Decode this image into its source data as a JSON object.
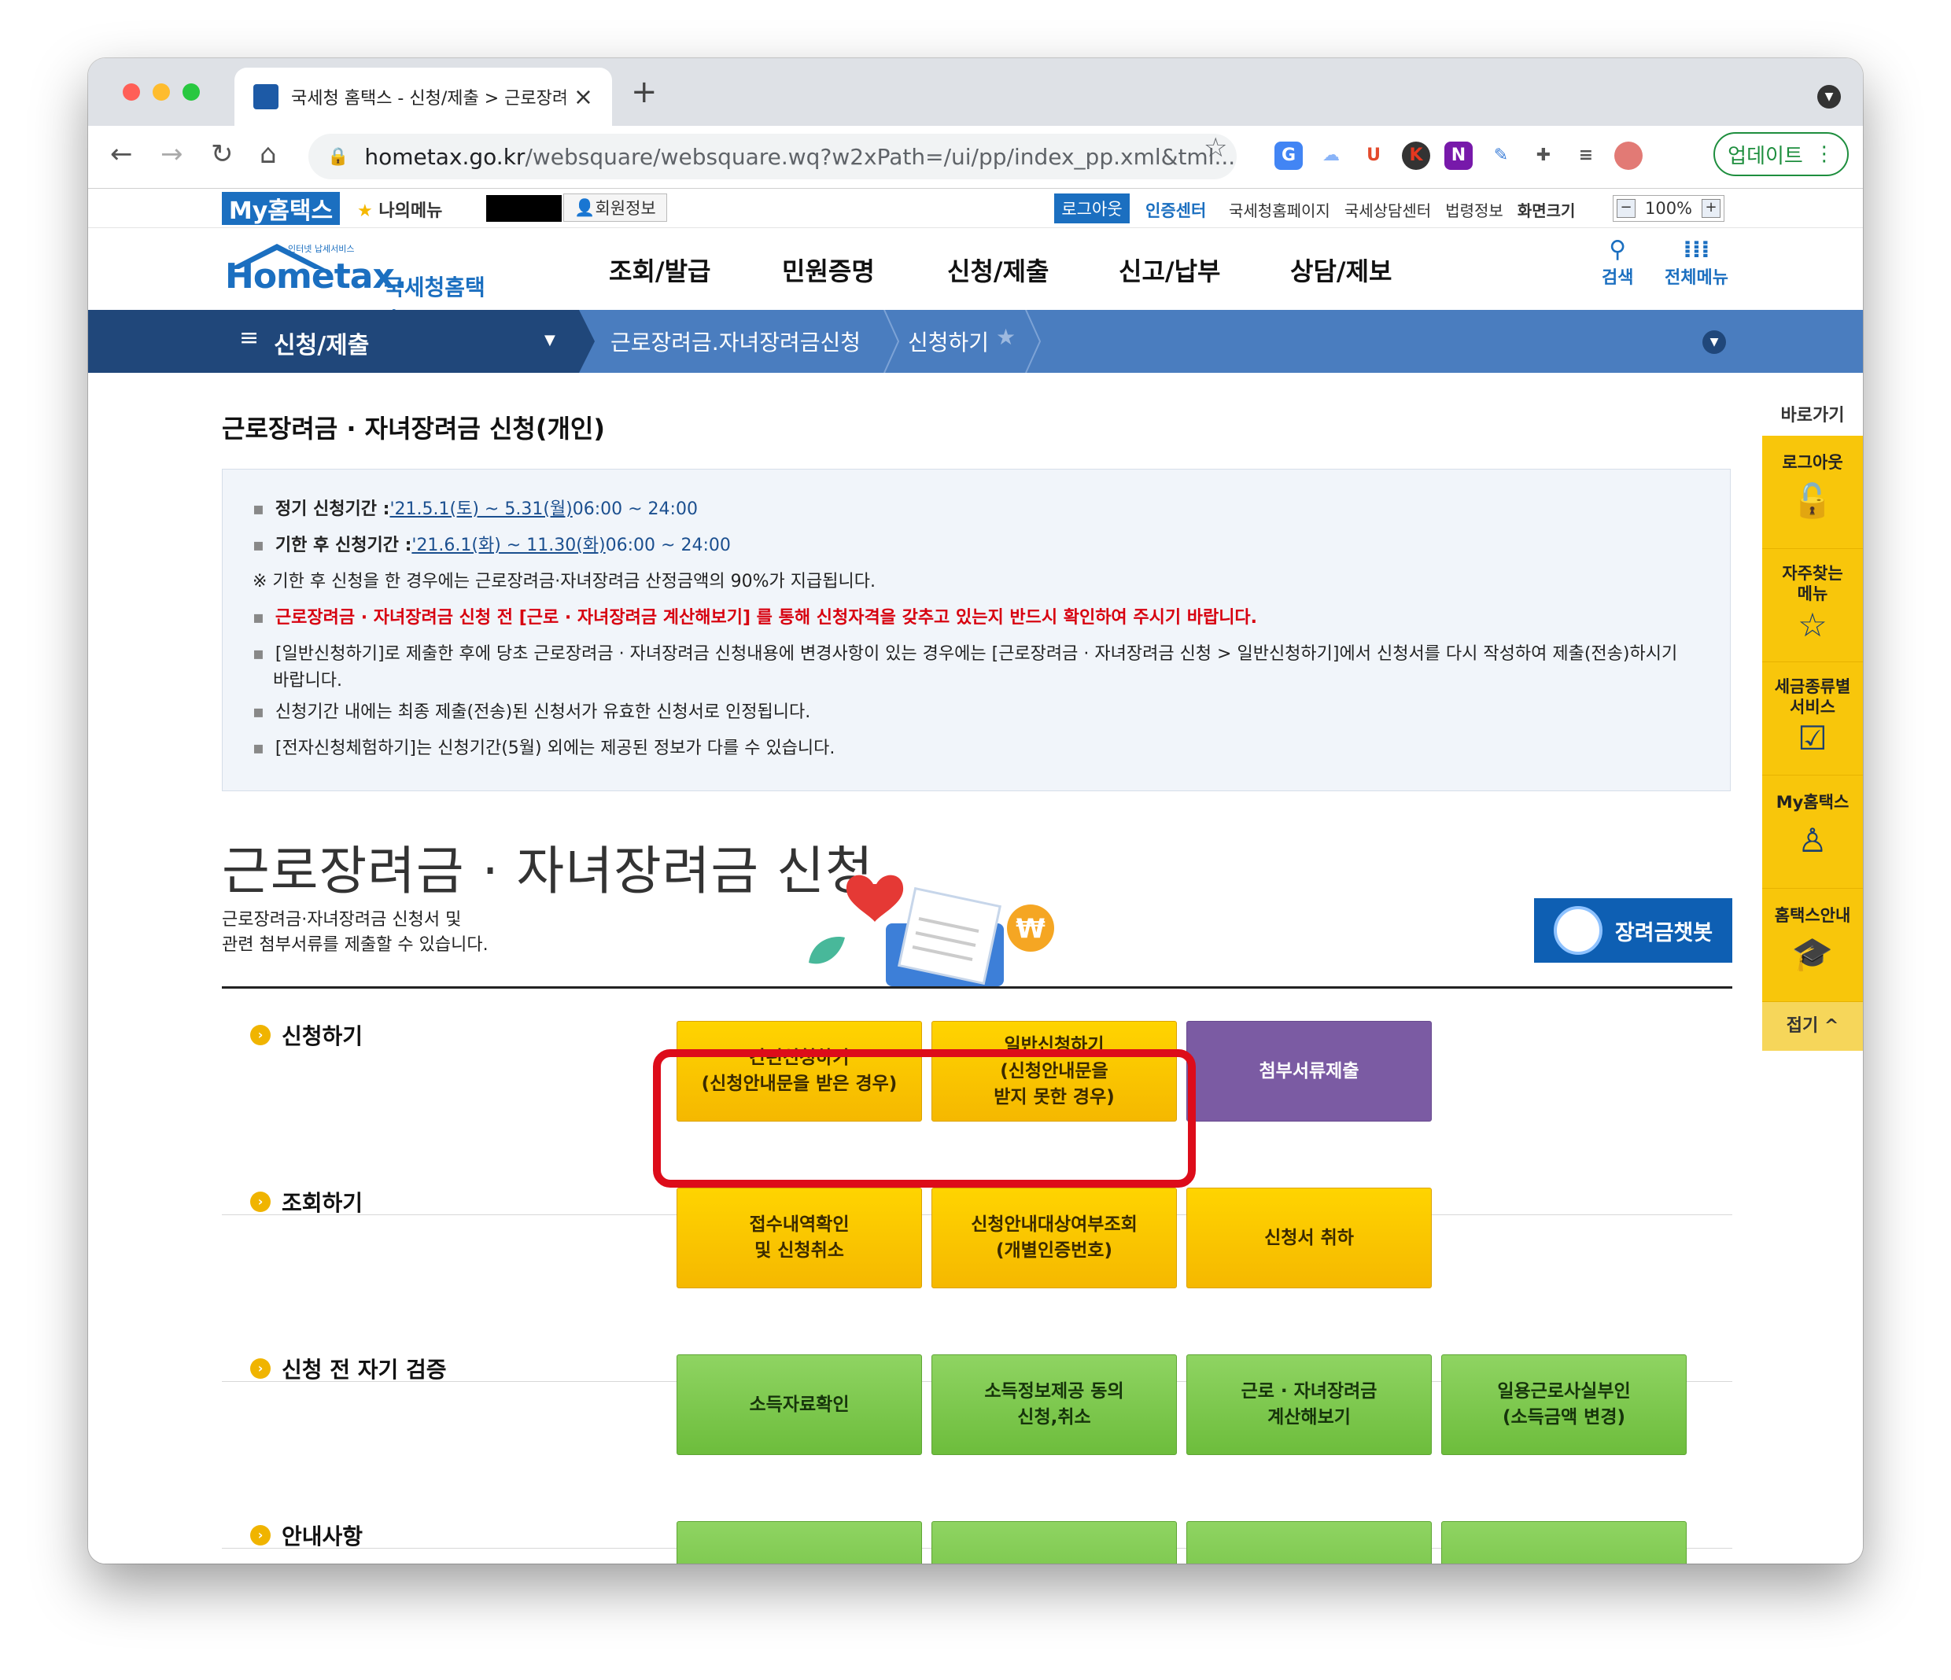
{
  "browser": {
    "tab_title": "국세청 홈택스 - 신청/제출 > 근로장려",
    "url_host": "hometax.go.kr",
    "url_path": "/websquare/websquare.wq?w2xPath=/ui/pp/index_pp.xml&tml...",
    "update_label": "업데이트"
  },
  "topstrip": {
    "my_hometax": "My홈택스",
    "my_menu": "나의메뉴",
    "member_info": "회원정보",
    "logout": "로그아웃",
    "cert_center": "인증센터",
    "links": [
      "국세청홈페이지",
      "국세상담센터",
      "법령정보",
      "화면크기"
    ],
    "zoom": "100%"
  },
  "header": {
    "logo_small": "인터넷 납세서비스",
    "logo_main": "Hometax.",
    "logo_kor": "국세청홈택스",
    "nav": [
      "조회/발급",
      "민원증명",
      "신청/제출",
      "신고/납부",
      "상담/제보"
    ],
    "search": "검색",
    "all_menu": "전체메뉴"
  },
  "crumbs": {
    "section": "신청/제출",
    "c1": "근로장려금.자녀장려금신청",
    "c2": "신청하기"
  },
  "page": {
    "title": "근로장려금 · 자녀장려금 신청(개인)",
    "info": {
      "l1_label": "정기 신청기간 : ",
      "l1_link": "'21.5.1(토) ~ 5.31(월)",
      "l1_time": " 06:00 ~ 24:00",
      "l2_label": "기한 후 신청기간 : ",
      "l2_link": "'21.6.1(화) ~ 11.30(화)",
      "l2_time": " 06:00 ~ 24:00",
      "l3": "※ 기한 후 신청을 한 경우에는 근로장려금·자녀장려금 산정금액의 90%가 지급됩니다.",
      "l4": "근로장려금 · 자녀장려금 신청 전 [근로 · 자녀장려금 계산해보기] 를 통해 신청자격을 갖추고 있는지 반드시 확인하여 주시기 바랍니다.",
      "l5": "[일반신청하기]로 제출한 후에 당초 근로장려금 · 자녀장려금 신청내용에 변경사항이 있는 경우에는 [근로장려금 · 자녀장려금 신청 > 일반신청하기]에서 신청서를 다시 작성하여 제출(전송)하시기",
      "l5b": "바랍니다.",
      "l6": "신청기간 내에는 최종 제출(전송)된 신청서가 유효한 신청서로 인정됩니다.",
      "l7": "[전자신청체험하기]는 신청기간(5월) 외에는 제공된 정보가 다를 수 있습니다."
    },
    "big_title": "근로장려금 · 자녀장려금 신청",
    "desc1": "근로장려금·자녀장려금 신청서 및",
    "desc2": "관련 첨부서류를 제출할 수 있습니다.",
    "chatbot": "장려금챗봇"
  },
  "rows": {
    "apply": {
      "label": "신청하기",
      "b1": "간편신청하기\n(신청안내문을 받은 경우)",
      "b2": "일반신청하기\n(신청안내문을\n받지 못한 경우)",
      "b3": "첨부서류제출"
    },
    "lookup": {
      "label": "조회하기",
      "b1": "접수내역확인\n및 신청취소",
      "b2": "신청안내대상여부조회\n(개별인증번호)",
      "b3": "신청서 취하"
    },
    "verify": {
      "label": "신청 전 자기 검증",
      "b1": "소득자료확인",
      "b2": "소득정보제공 동의\n신청,취소",
      "b3": "근로 · 자녀장려금\n계산해보기",
      "b4": "일용근로사실부인\n(소득금액 변경)"
    },
    "notice": {
      "label": "안내사항"
    }
  },
  "quick": {
    "title": "바로가기",
    "items": [
      "로그아웃",
      "자주찾는\n메뉴",
      "세금종류별\n서비스",
      "My홈택스",
      "홈택스안내"
    ],
    "fold": "접기 ^"
  },
  "colors": {
    "brand_blue": "#1b6fc0",
    "nav_dark": "#20477a",
    "nav_light": "#4a7dbf",
    "button_yellow": "#ffd400",
    "button_green": "#7cc84d",
    "button_purple": "#7b5ba3",
    "highlight_red": "#dd0c1a",
    "quick_yellow": "#f8c60b"
  }
}
